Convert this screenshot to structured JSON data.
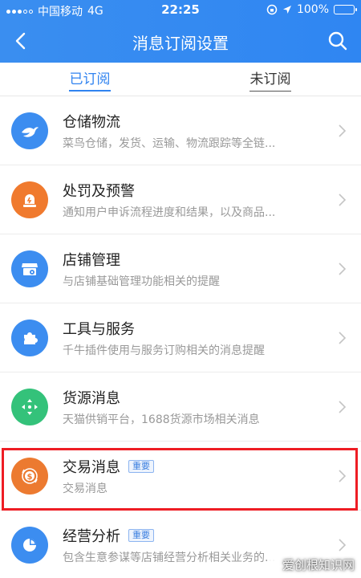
{
  "status_bar": {
    "carrier": "中国移动",
    "network": "4G",
    "time": "22:25",
    "battery": "100%"
  },
  "nav": {
    "title": "消息订阅设置"
  },
  "tabs": [
    {
      "label": "已订阅",
      "active": true
    },
    {
      "label": "未订阅",
      "active": false
    }
  ],
  "items": [
    {
      "title": "仓储物流",
      "desc": "菜鸟仓储，发货、运输、物流跟踪等全链...",
      "icon": "bird-icon",
      "color": "#3c8df0",
      "badge": ""
    },
    {
      "title": "处罚及预警",
      "desc": "通知用户申诉流程进度和结果，以及商品...",
      "icon": "alert-icon",
      "color": "#f07a2e",
      "badge": ""
    },
    {
      "title": "店铺管理",
      "desc": "与店铺基础管理功能相关的提醒",
      "icon": "store-icon",
      "color": "#3c8df0",
      "badge": ""
    },
    {
      "title": "工具与服务",
      "desc": "千牛插件使用与服务订购相关的消息提醒",
      "icon": "puzzle-icon",
      "color": "#3c8df0",
      "badge": ""
    },
    {
      "title": "货源消息",
      "desc": "天猫供销平台，1688货源市场相关消息",
      "icon": "move-icon",
      "color": "#34c27a",
      "badge": ""
    },
    {
      "title": "交易消息",
      "desc": "交易消息",
      "icon": "coin-exchange-icon",
      "color": "#ec7a30",
      "badge": "重要"
    },
    {
      "title": "经营分析",
      "desc": "包含生意参谋等店铺经营分析相关业务的...",
      "icon": "pie-chart-icon",
      "color": "#3c8df0",
      "badge": "重要"
    }
  ],
  "watermark": {
    "text": "爱创根知识网"
  }
}
